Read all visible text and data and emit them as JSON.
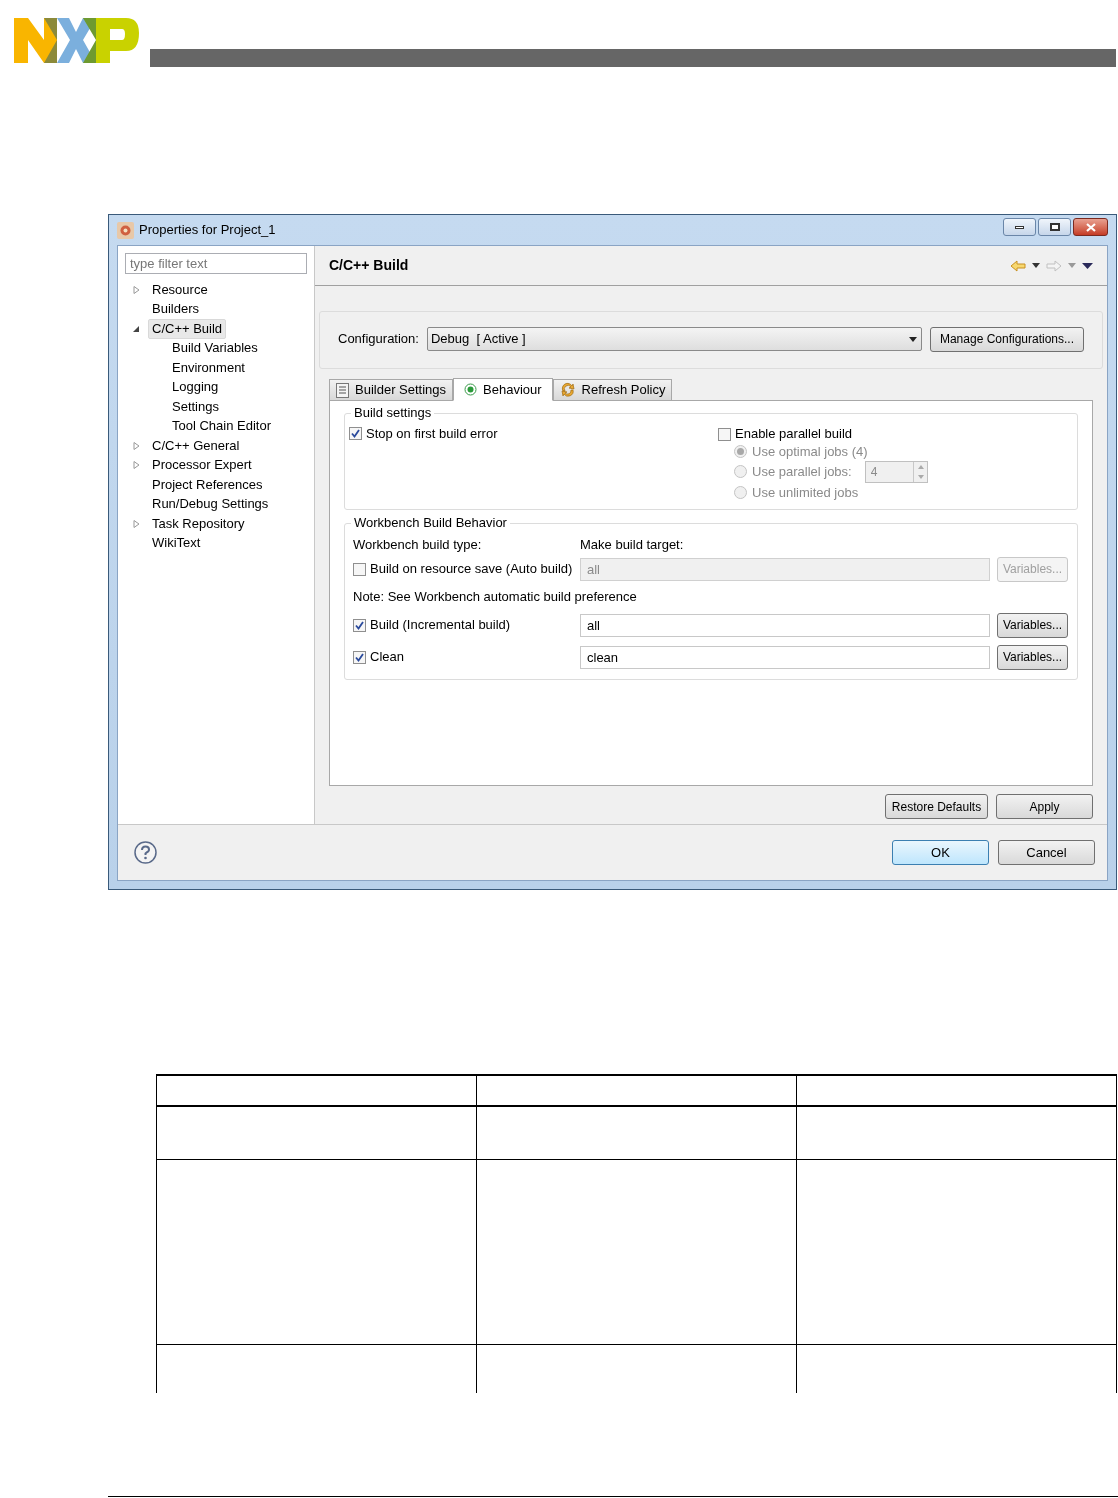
{
  "window": {
    "title": "Properties for Project_1"
  },
  "sidebar": {
    "filter": {
      "placeholder": "type filter text"
    },
    "items": [
      {
        "label": "Resource",
        "expanded": false,
        "selected": false
      },
      {
        "label": "Builders",
        "selected": false
      },
      {
        "label": "C/C++ Build",
        "expanded": true,
        "selected": true,
        "children": [
          {
            "label": "Build Variables",
            "selected": false
          },
          {
            "label": "Environment",
            "selected": false
          },
          {
            "label": "Logging",
            "selected": false
          },
          {
            "label": "Settings",
            "selected": false
          },
          {
            "label": "Tool Chain Editor",
            "selected": false
          }
        ]
      },
      {
        "label": "C/C++ General",
        "expanded": false,
        "selected": false
      },
      {
        "label": "Processor Expert",
        "expanded": false,
        "selected": false
      },
      {
        "label": "Project References",
        "selected": false
      },
      {
        "label": "Run/Debug Settings",
        "selected": false
      },
      {
        "label": "Task Repository",
        "expanded": false,
        "selected": false
      },
      {
        "label": "WikiText",
        "selected": false
      }
    ]
  },
  "page": {
    "title": "C/C++ Build",
    "configuration": {
      "label": "Configuration:",
      "value": "Debug  [ Active ]",
      "button": "Manage Configurations..."
    },
    "tabs": [
      {
        "label": "Builder Settings",
        "kind": "list",
        "selected": false
      },
      {
        "label": "Behaviour",
        "kind": "radio",
        "selected": true
      },
      {
        "label": "Refresh Policy",
        "kind": "refresh",
        "selected": false
      }
    ],
    "build_settings": {
      "title": "Build settings",
      "stop_on_error": {
        "label": "Stop on first build error",
        "checked": true
      },
      "parallel": {
        "label": "Enable parallel build",
        "checked": false
      },
      "options": [
        {
          "label": "Use optimal jobs (4)",
          "selected": true,
          "disabled": true
        },
        {
          "label": "Use parallel jobs:",
          "selected": false,
          "disabled": true,
          "value": "4"
        },
        {
          "label": "Use unlimited jobs",
          "selected": false,
          "disabled": true
        }
      ]
    },
    "workbench": {
      "title": "Workbench Build Behavior",
      "type_heading": "Workbench build type:",
      "target_heading": "Make build target:",
      "rows": [
        {
          "label": "Build on resource save (Auto build)",
          "checked": false,
          "value": "all",
          "button": "Variables..."
        },
        {
          "kind": "note",
          "label": "Note: See Workbench automatic build preference"
        },
        {
          "label": "Build (Incremental build)",
          "checked": true,
          "value": "all",
          "button": "Variables..."
        },
        {
          "label": "Clean",
          "checked": true,
          "value": "clean",
          "button": "Variables..."
        }
      ]
    },
    "buttons": [
      "Restore Defaults",
      "Apply"
    ]
  },
  "footer": {
    "buttons": [
      {
        "label": "OK",
        "default": true
      },
      {
        "label": "Cancel",
        "default": false
      }
    ]
  }
}
